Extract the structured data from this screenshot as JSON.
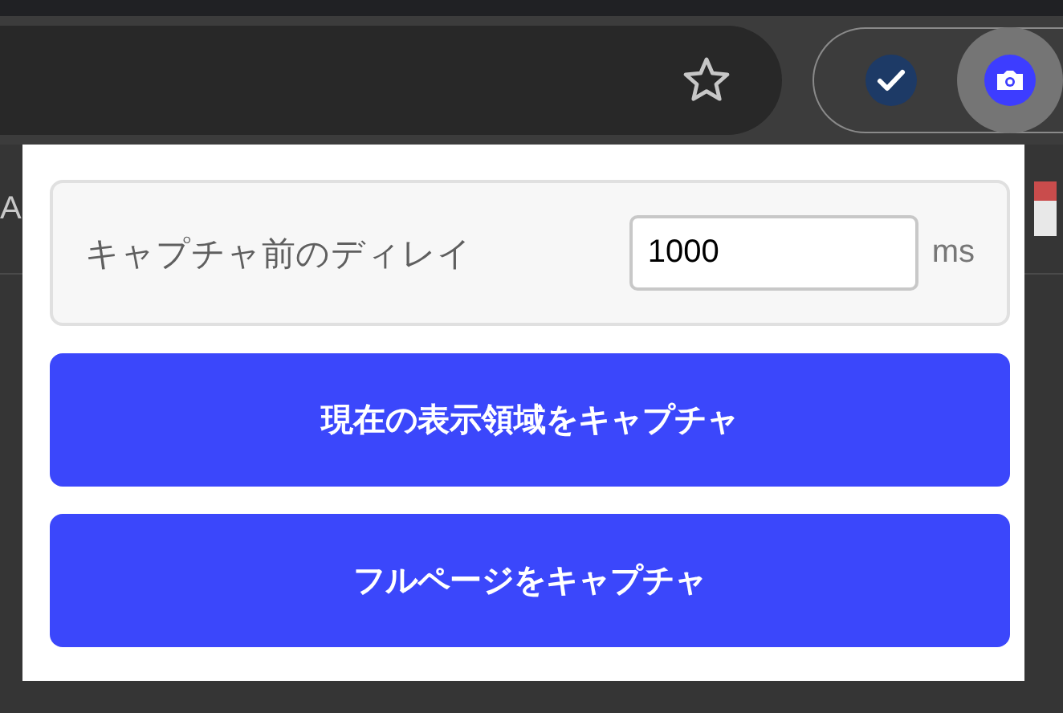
{
  "bookmarks_bar": {
    "items": [
      "A"
    ]
  },
  "extensions": [
    {
      "kind": "check",
      "selected": false
    },
    {
      "kind": "camera",
      "selected": true
    }
  ],
  "popup": {
    "delay": {
      "label": "キャプチャ前のディレイ",
      "value": "1000",
      "unit": "ms"
    },
    "buttons": [
      "現在の表示領域をキャプチャ",
      "フルページをキャプチャ"
    ]
  }
}
